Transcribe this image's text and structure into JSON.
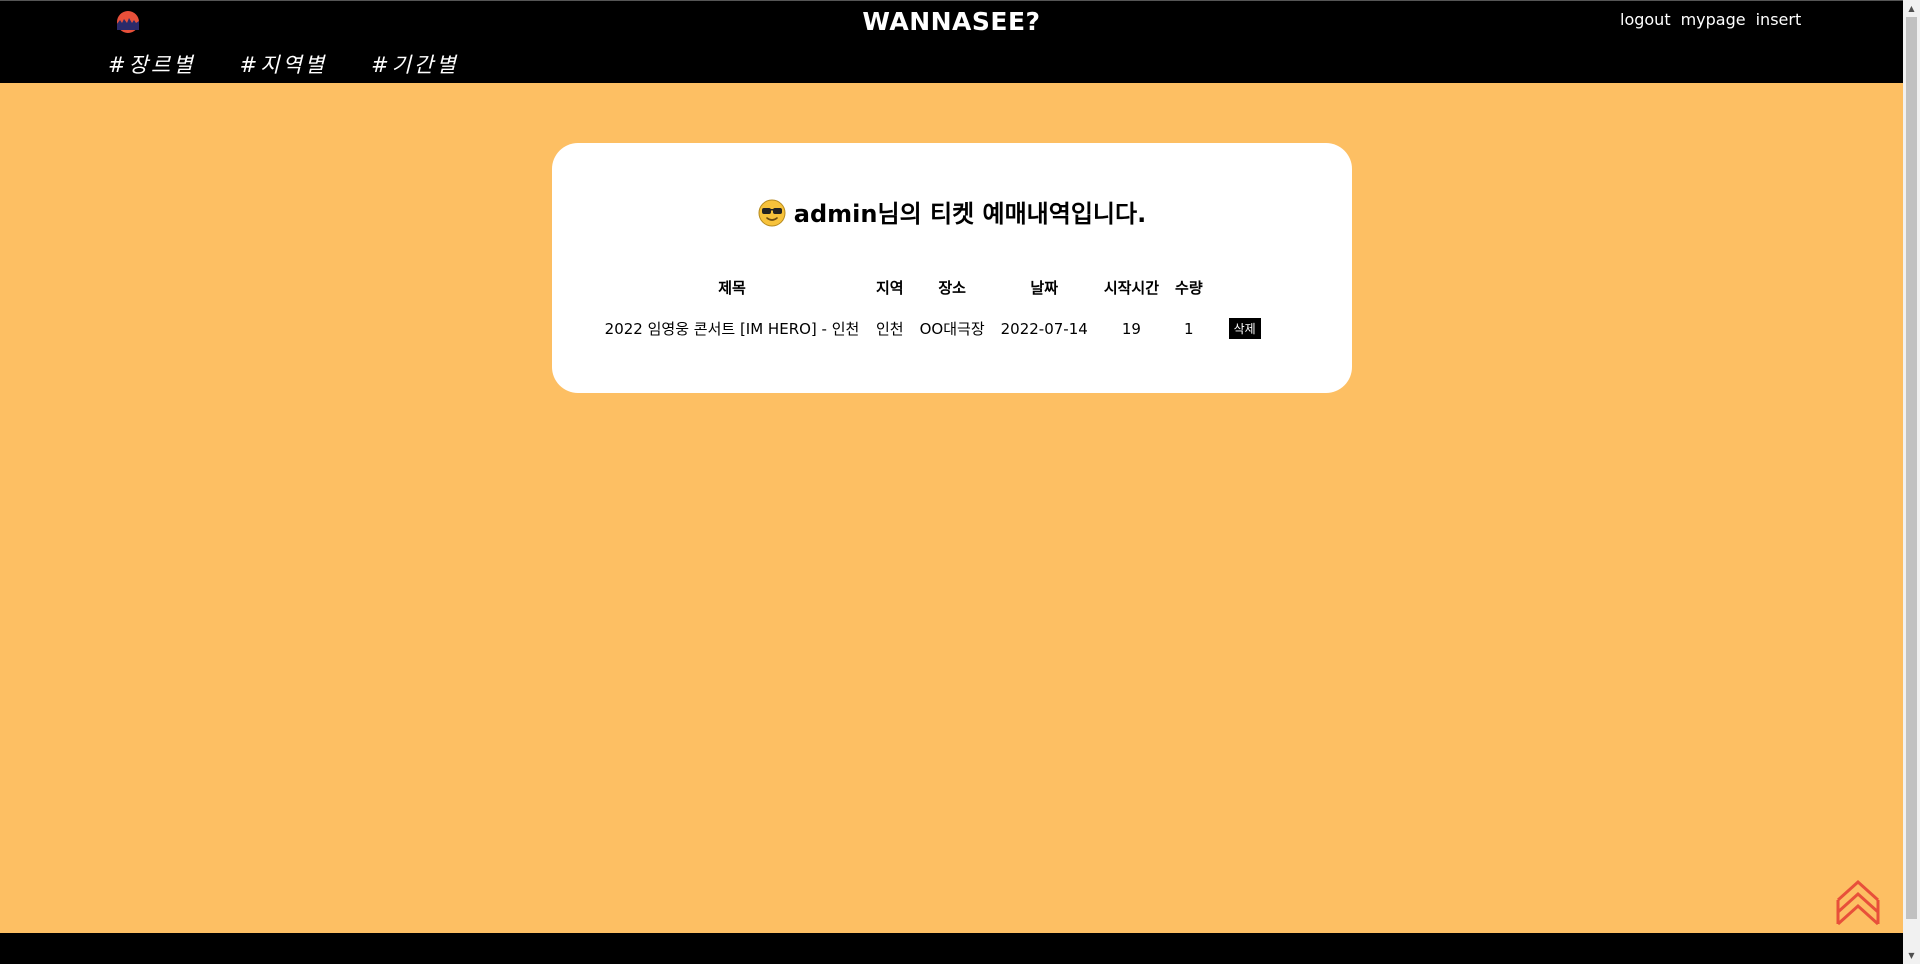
{
  "header": {
    "site_title": "WANNASEE?",
    "links": [
      "logout",
      "mypage",
      "insert"
    ],
    "nav": [
      "#장르별",
      "#지역별",
      "#기간별"
    ]
  },
  "card": {
    "username": "admin",
    "title_suffix": "님의 티켓 예매내역입니다.",
    "columns": [
      "제목",
      "지역",
      "장소",
      "날짜",
      "시작시간",
      "수량"
    ],
    "rows": [
      {
        "title": "2022 임영웅 콘서트 [IM HERO] - 인천",
        "region": "인천",
        "venue": "OO대극장",
        "date": "2022-07-14",
        "start_time": "19",
        "quantity": "1",
        "delete_label": "삭제"
      }
    ]
  },
  "colors": {
    "background": "#fdbf63",
    "header": "#000000",
    "card": "#ffffff",
    "top_button": "#e8503a"
  },
  "icons": {
    "logo": "logo-icon",
    "title_emoji": "sunglasses-face-icon",
    "back_to_top": "double-chevron-up-icon"
  }
}
